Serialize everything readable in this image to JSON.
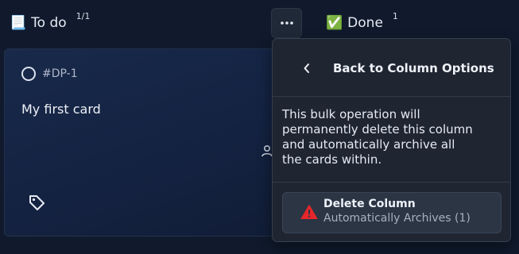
{
  "columns": [
    {
      "icon": "memo-emoji",
      "emoji": "📃",
      "title": "To do",
      "count": "1/1"
    },
    {
      "icon": "check-mark-emoji",
      "emoji": "✅",
      "title": "Done",
      "count": "1"
    }
  ],
  "column_menu_button": {
    "icon": "more-horizontal-icon"
  },
  "card": {
    "status_icon": "circle-outline-icon",
    "id": "#DP-1",
    "title": "My first card",
    "assignee_icon": "person-icon",
    "tag_icon": "tag-icon"
  },
  "popover": {
    "back_icon": "chevron-left-icon",
    "back_label": "Back to Column Options",
    "description": "This bulk operation will permanently delete this column and automatically archive all the cards within.",
    "delete_button": {
      "icon": "warning-icon",
      "label": "Delete Column",
      "sublabel": "Automatically Archives (1)"
    }
  },
  "colors": {
    "background": "#101a2c",
    "card": "#18294a",
    "popover": "#1f2632",
    "warning": "#e5262a"
  }
}
